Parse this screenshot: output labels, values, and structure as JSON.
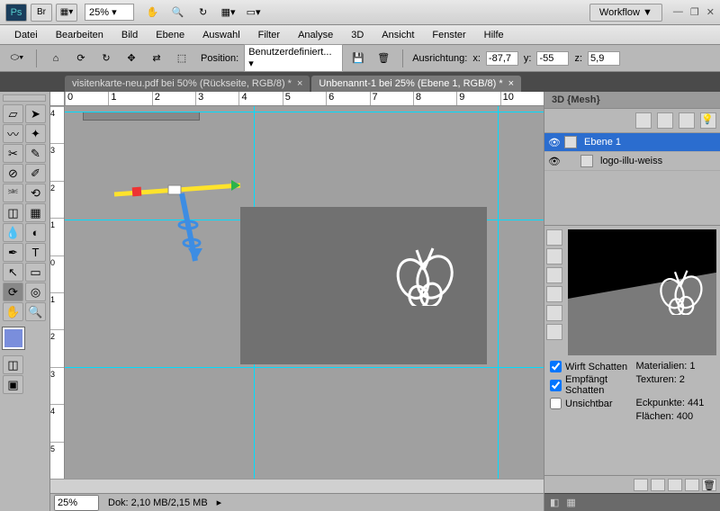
{
  "titlebar": {
    "ps_label": "Ps",
    "br_label": "Br",
    "zoom": "25%",
    "workflow": "Workflow ▼"
  },
  "menu": {
    "items": [
      "Datei",
      "Bearbeiten",
      "Bild",
      "Ebene",
      "Auswahl",
      "Filter",
      "Analyse",
      "3D",
      "Ansicht",
      "Fenster",
      "Hilfe"
    ]
  },
  "options": {
    "position_label": "Position:",
    "position_value": "Benutzerdefiniert...",
    "ausrichtung_label": "Ausrichtung:",
    "x_label": "x:",
    "x_value": "-87,7",
    "y_label": "y:",
    "y_value": "-55",
    "z_label": "z:",
    "z_value": "5,9"
  },
  "tabs": {
    "tab1_name": "visitenkarte-neu.pdf bei 50% (Rückseite, RGB/8) *",
    "tab2_name": "Unbenannt-1 bei 25% (Ebene 1, RGB/8) *"
  },
  "ruler_h": [
    "0",
    "1",
    "2",
    "3",
    "4",
    "5",
    "6",
    "7",
    "8",
    "9",
    "10"
  ],
  "ruler_v": [
    "4",
    "3",
    "2",
    "1",
    "0",
    "1",
    "2",
    "3",
    "4",
    "5"
  ],
  "status": {
    "zoom": "25%",
    "dok": "Dok: 2,10 MB/2,15 MB"
  },
  "panel3d": {
    "title": "3D {Mesh}",
    "layer1": "Ebene 1",
    "layer2": "logo-illu-weiss",
    "wirft_schatten": "Wirft Schatten",
    "empfangt_schatten": "Empfängt Schatten",
    "unsichtbar": "Unsichtbar",
    "materialien": "Materialien: 1",
    "texturen": "Texturen: 2",
    "eckpunkte": "Eckpunkte: 441",
    "flachen": "Flächen: 400"
  }
}
